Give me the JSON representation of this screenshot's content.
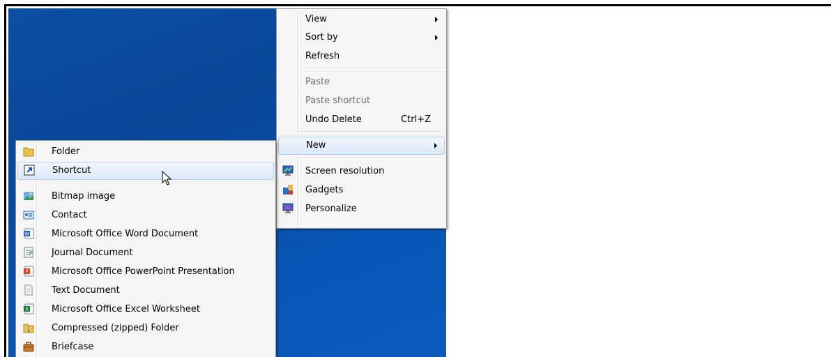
{
  "context_menu": {
    "view": "View",
    "sort_by": "Sort by",
    "refresh": "Refresh",
    "paste": "Paste",
    "paste_shortcut": "Paste shortcut",
    "undo_delete": "Undo Delete",
    "undo_shortcut_key": "Ctrl+Z",
    "new": "New",
    "screen_resolution": "Screen resolution",
    "gadgets": "Gadgets",
    "personalize": "Personalize"
  },
  "new_submenu": {
    "items": [
      {
        "label": "Folder",
        "icon": "folder-icon"
      },
      {
        "label": "Shortcut",
        "icon": "shortcut-icon"
      },
      {
        "label": "Bitmap image",
        "icon": "bitmap-icon"
      },
      {
        "label": "Contact",
        "icon": "contact-icon"
      },
      {
        "label": "Microsoft Office Word Document",
        "icon": "word-icon"
      },
      {
        "label": "Journal Document",
        "icon": "journal-icon"
      },
      {
        "label": "Microsoft Office PowerPoint Presentation",
        "icon": "powerpoint-icon"
      },
      {
        "label": "Text Document",
        "icon": "text-document-icon"
      },
      {
        "label": "Microsoft Office Excel Worksheet",
        "icon": "excel-icon"
      },
      {
        "label": "Compressed (zipped) Folder",
        "icon": "zip-folder-icon"
      },
      {
        "label": "Briefcase",
        "icon": "briefcase-icon"
      }
    ]
  },
  "colors": {
    "desktop": "#0b4fa3",
    "menu_background": "#f5f5f5",
    "hover_border": "#aecff7",
    "disabled_text": "#6d6d6d"
  }
}
